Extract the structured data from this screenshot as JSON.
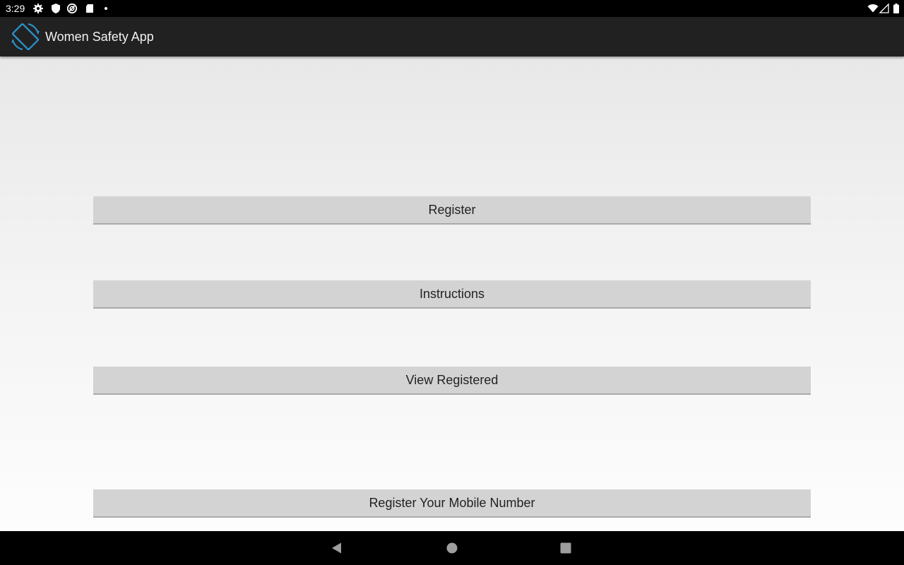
{
  "status_bar": {
    "time": "3:29",
    "left_icons": [
      "gear-icon",
      "shield-icon",
      "at-sign-icon",
      "sd-card-icon",
      "notification-dot-icon"
    ],
    "right_icons": [
      "wifi-icon",
      "cell-signal-icon",
      "battery-icon"
    ]
  },
  "app_bar": {
    "title": "Women Safety App",
    "logo_icon": "screen-rotate-icon",
    "accent_color": "#2a8fc7"
  },
  "main": {
    "buttons": [
      {
        "label": "Register"
      },
      {
        "label": "Instructions"
      },
      {
        "label": "View Registered"
      },
      {
        "label": "Register Your Mobile Number"
      }
    ]
  },
  "nav_bar": {
    "buttons": [
      "back-icon",
      "home-icon",
      "recents-icon"
    ]
  }
}
